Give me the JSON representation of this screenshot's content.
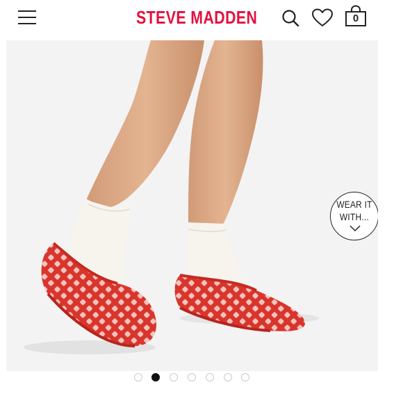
{
  "header": {
    "brand": "STEVE MADDEN",
    "menu_icon": "hamburger-menu-icon",
    "search_icon": "search-icon",
    "wishlist_icon": "heart-icon",
    "cart_icon": "shopping-bag-icon",
    "cart_count": "0",
    "brand_color": "#e4103e"
  },
  "hero": {
    "image_description_icon": "product-photo",
    "wear_it_with": {
      "line1": "WEAR IT",
      "line2": "WITH...",
      "icon": "chevron-down-icon"
    }
  },
  "carousel": {
    "total": 7,
    "active_index": 1
  }
}
